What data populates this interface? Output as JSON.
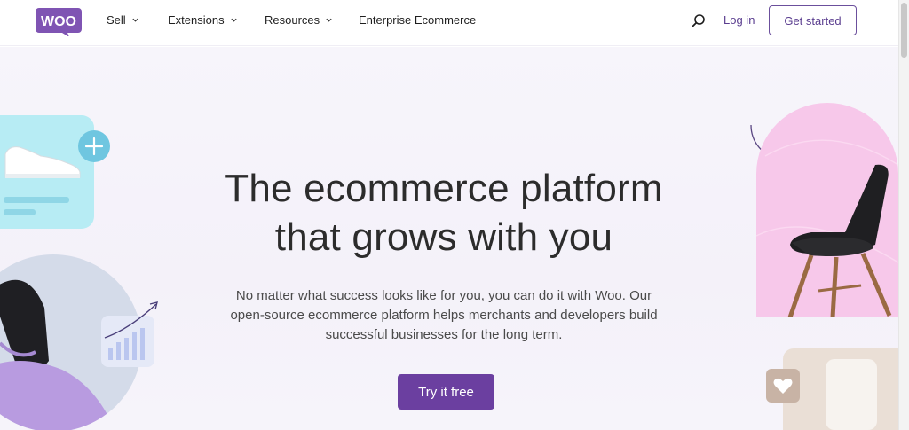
{
  "nav": {
    "logo": "WOO",
    "items": [
      {
        "label": "Sell",
        "dropdown": true
      },
      {
        "label": "Extensions",
        "dropdown": true
      },
      {
        "label": "Resources",
        "dropdown": true
      },
      {
        "label": "Enterprise Ecommerce",
        "dropdown": false
      }
    ],
    "search_icon": "search-icon",
    "login_label": "Log in",
    "get_started_label": "Get started"
  },
  "hero": {
    "headline_line1": "The ecommerce platform",
    "headline_line2": "that grows with you",
    "subtext_line1": "No matter what success looks like for you, you can do it with Woo. Our",
    "subtext_line2": "open-source ecommerce platform helps merchants and developers build",
    "subtext_line3": "successful businesses for the long term.",
    "cta_label": "Try it free"
  },
  "colors": {
    "brand_purple": "#6b3fa0",
    "link_purple": "#5a3d8f",
    "hero_bg": "#f5f2fa",
    "text_dark": "#2c2c2c"
  }
}
